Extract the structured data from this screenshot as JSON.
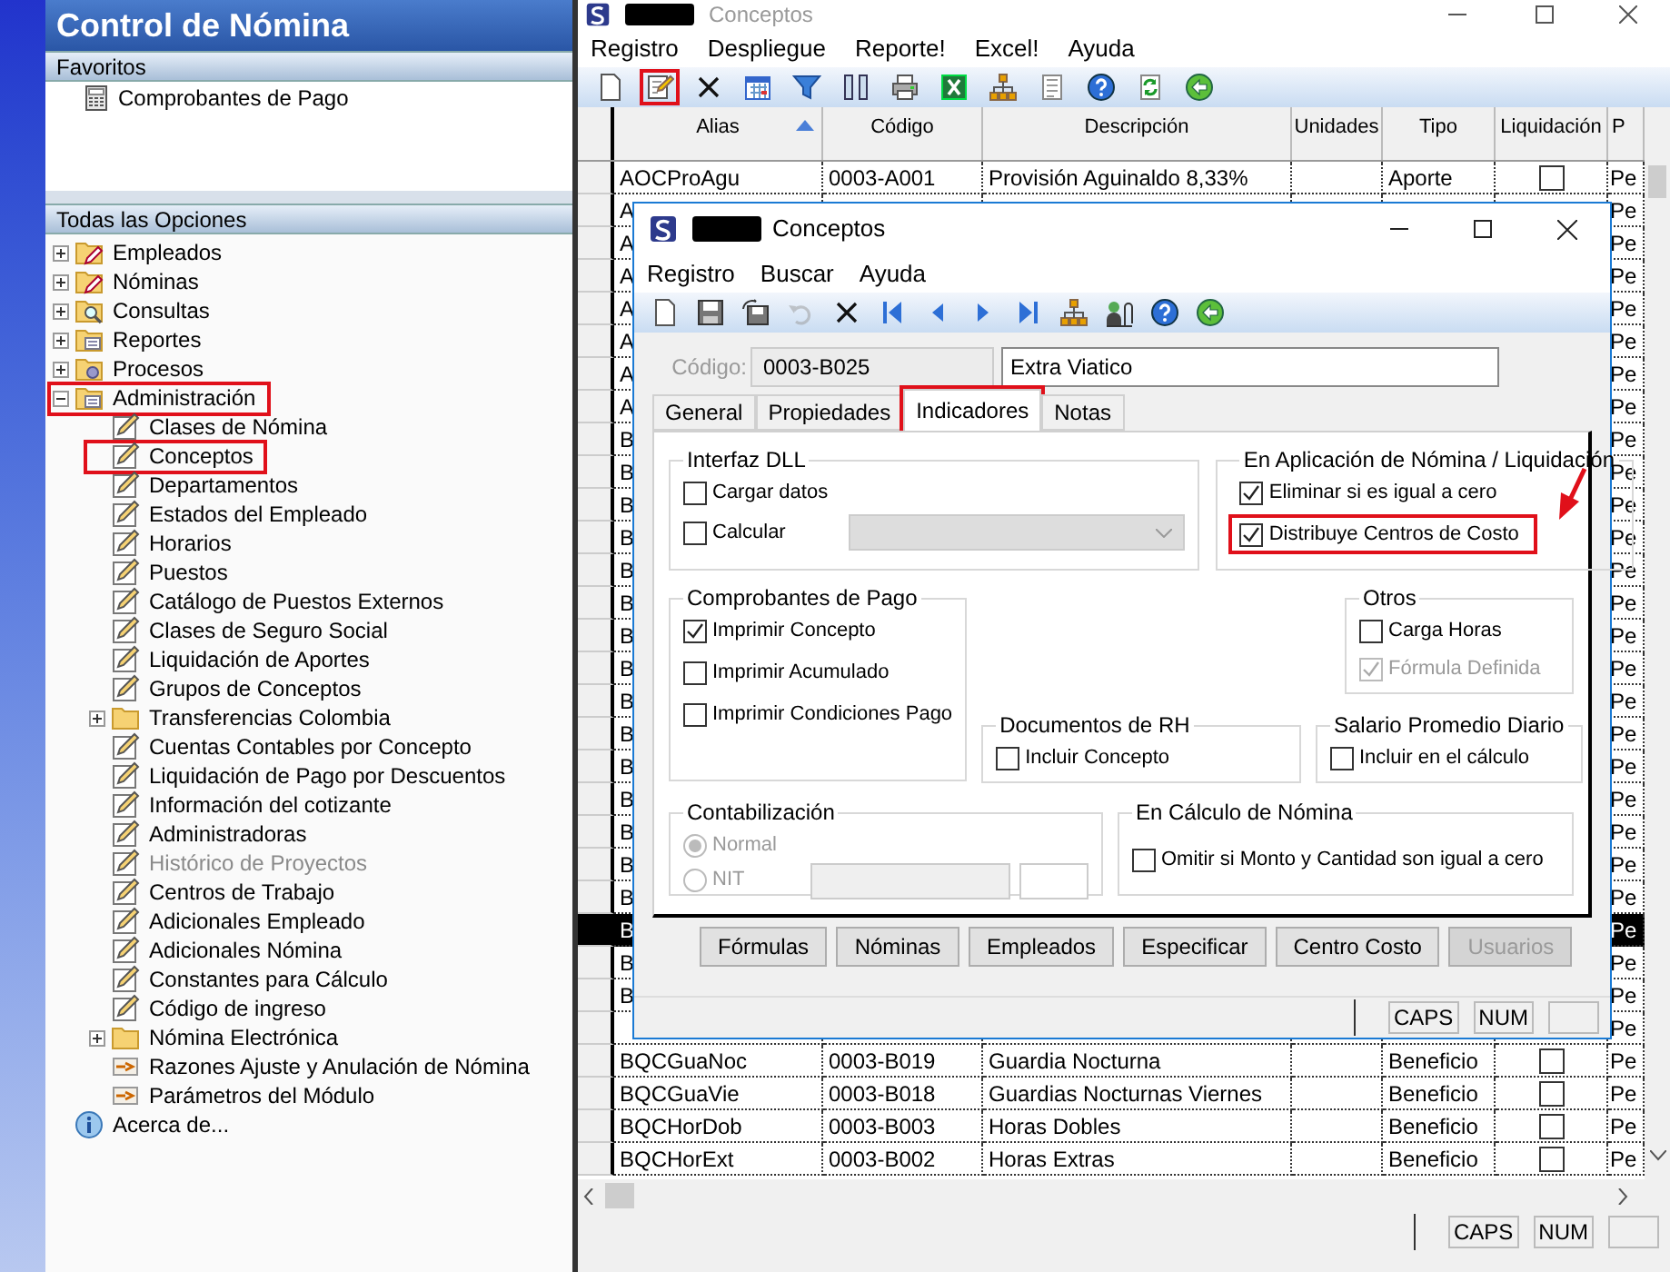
{
  "nav_panel": {
    "title": "Control de Nómina",
    "favorites": {
      "header": "Favoritos",
      "items": [
        {
          "label": "Comprobantes de Pago",
          "kind": "calculator"
        }
      ]
    },
    "all_options": {
      "header": "Todas las Opciones",
      "tree": [
        {
          "label": "Empleados",
          "kind": "folder_edit",
          "expanded": false,
          "disabled": false,
          "highlighted": false
        },
        {
          "label": "Nóminas",
          "kind": "folder_edit",
          "expanded": false,
          "disabled": false,
          "highlighted": false
        },
        {
          "label": "Consultas",
          "kind": "folder_search",
          "expanded": false,
          "disabled": false,
          "highlighted": false
        },
        {
          "label": "Reportes",
          "kind": "folder_list",
          "expanded": false,
          "disabled": false,
          "highlighted": false
        },
        {
          "label": "Procesos",
          "kind": "folder_gear",
          "expanded": false,
          "disabled": false,
          "highlighted": false
        },
        {
          "label": "Administración",
          "kind": "folder_list",
          "expanded": true,
          "disabled": false,
          "highlighted": true,
          "children": [
            {
              "label": "Clases de Nómina",
              "kind": "page",
              "disabled": false,
              "highlighted": false
            },
            {
              "label": "Conceptos",
              "kind": "page",
              "disabled": false,
              "highlighted": true
            },
            {
              "label": "Departamentos",
              "kind": "page",
              "disabled": false,
              "highlighted": false
            },
            {
              "label": "Estados del Empleado",
              "kind": "page",
              "disabled": false,
              "highlighted": false
            },
            {
              "label": "Horarios",
              "kind": "page",
              "disabled": false,
              "highlighted": false
            },
            {
              "label": "Puestos",
              "kind": "page",
              "disabled": false,
              "highlighted": false
            },
            {
              "label": "Catálogo de Puestos Externos",
              "kind": "page",
              "disabled": false,
              "highlighted": false
            },
            {
              "label": "Clases de Seguro Social",
              "kind": "page",
              "disabled": false,
              "highlighted": false
            },
            {
              "label": "Liquidación de Aportes",
              "kind": "page",
              "disabled": false,
              "highlighted": false
            },
            {
              "label": "Grupos de Conceptos",
              "kind": "page",
              "disabled": false,
              "highlighted": false
            },
            {
              "label": "Transferencias Colombia",
              "kind": "folder",
              "expanded": false,
              "disabled": false,
              "highlighted": false
            },
            {
              "label": "Cuentas Contables por Concepto",
              "kind": "page",
              "disabled": false,
              "highlighted": false
            },
            {
              "label": "Liquidación de Pago por Descuentos",
              "kind": "page",
              "disabled": false,
              "highlighted": false
            },
            {
              "label": "Información del cotizante",
              "kind": "page",
              "disabled": false,
              "highlighted": false
            },
            {
              "label": "Administradoras",
              "kind": "page",
              "disabled": false,
              "highlighted": false
            },
            {
              "label": "Histórico de Proyectos",
              "kind": "page",
              "disabled": true,
              "highlighted": false
            },
            {
              "label": "Centros de Trabajo",
              "kind": "page",
              "disabled": false,
              "highlighted": false
            },
            {
              "label": "Adicionales Empleado",
              "kind": "page",
              "disabled": false,
              "highlighted": false
            },
            {
              "label": "Adicionales Nómina",
              "kind": "page",
              "disabled": false,
              "highlighted": false
            },
            {
              "label": "Constantes para Cálculo",
              "kind": "page",
              "disabled": false,
              "highlighted": false
            },
            {
              "label": "Código de ingreso",
              "kind": "page",
              "disabled": false,
              "highlighted": false
            },
            {
              "label": "Nómina Electrónica",
              "kind": "folder",
              "expanded": false,
              "disabled": false,
              "highlighted": false
            },
            {
              "label": "Razones Ajuste y Anulación de Nómina",
              "kind": "tool",
              "disabled": false,
              "highlighted": false
            },
            {
              "label": "Parámetros del Módulo",
              "kind": "tool",
              "disabled": false,
              "highlighted": false
            }
          ]
        },
        {
          "label": "Acerca de...",
          "kind": "info",
          "disabled": false,
          "highlighted": false
        }
      ]
    }
  },
  "main_window": {
    "title": "Conceptos",
    "menu": [
      "Registro",
      "Despliegue",
      "Reporte!",
      "Excel!",
      "Ayuda"
    ],
    "toolbar": [
      {
        "kind": "new",
        "highlighted": false
      },
      {
        "kind": "edit",
        "highlighted": true
      },
      {
        "kind": "delete",
        "highlighted": false
      },
      {
        "kind": "calendar",
        "highlighted": false
      },
      {
        "kind": "filter",
        "highlighted": false
      },
      {
        "kind": "columns",
        "highlighted": false
      },
      {
        "kind": "print",
        "highlighted": false
      },
      {
        "kind": "excel",
        "highlighted": false
      },
      {
        "kind": "tree",
        "highlighted": false
      },
      {
        "kind": "document",
        "highlighted": false
      },
      {
        "kind": "help",
        "highlighted": false
      },
      {
        "kind": "refresh",
        "highlighted": false
      },
      {
        "kind": "back",
        "highlighted": false
      }
    ],
    "table": {
      "columns": [
        {
          "label": "Alias",
          "sorted": true
        },
        {
          "label": "Código",
          "sorted": false
        },
        {
          "label": "Descripción",
          "sorted": false
        },
        {
          "label": "Unidades",
          "sorted": false
        },
        {
          "label": "Tipo",
          "sorted": false
        },
        {
          "label": "Liquidación",
          "sorted": false
        },
        {
          "label": "P",
          "sorted": false
        }
      ],
      "rows": [
        {
          "alias": "AOCProAgu",
          "code": "0003-A001",
          "description": "Provisión Aguinaldo 8,33%",
          "type": "Aporte",
          "settlement": false,
          "column_7": "Pe",
          "selected": false
        },
        {
          "alias": "A",
          "column_7": "Pe",
          "selected": false
        },
        {
          "alias": "A",
          "column_7": "Pe",
          "selected": false
        },
        {
          "alias": "A",
          "column_7": "Pe",
          "selected": false
        },
        {
          "alias": "A",
          "column_7": "Pe",
          "selected": false
        },
        {
          "alias": "A",
          "column_7": "Pe",
          "selected": false
        },
        {
          "alias": "A",
          "column_7": "Pe",
          "selected": false
        },
        {
          "alias": "A",
          "column_7": "Pe",
          "selected": false
        },
        {
          "alias": "B",
          "column_7": "Pe",
          "selected": false
        },
        {
          "alias": "B",
          "column_7": "Pe",
          "selected": false
        },
        {
          "alias": "B",
          "column_7": "Pe",
          "selected": false
        },
        {
          "alias": "B",
          "column_7": "Pe",
          "selected": false
        },
        {
          "alias": "B",
          "column_7": "Pe",
          "selected": false
        },
        {
          "alias": "B",
          "column_7": "Pe",
          "selected": false
        },
        {
          "alias": "B",
          "column_7": "Pe",
          "selected": false
        },
        {
          "alias": "B",
          "column_7": "Pe",
          "selected": false
        },
        {
          "alias": "B",
          "column_7": "Pe",
          "selected": false
        },
        {
          "alias": "B",
          "column_7": "Pe",
          "selected": false
        },
        {
          "alias": "B",
          "column_7": "Pe",
          "selected": false
        },
        {
          "alias": "B",
          "column_7": "Pe",
          "selected": false
        },
        {
          "alias": "B",
          "column_7": "Pe",
          "selected": false
        },
        {
          "alias": "B",
          "column_7": "Pe",
          "selected": false
        },
        {
          "alias": "B",
          "column_7": "Pe",
          "selected": false
        },
        {
          "alias": "B",
          "column_7": "Pe",
          "selected": true
        },
        {
          "alias": "B",
          "column_7": "Pe",
          "selected": false
        },
        {
          "alias": "B",
          "column_7": "Pe",
          "selected": false
        },
        {
          "column_7": "Pe",
          "selected": false
        },
        {
          "alias": "BQCGuaNoc",
          "code": "0003-B019",
          "description": "Guardia Nocturna",
          "type": "Beneficio",
          "settlement": false,
          "column_7": "Pe",
          "selected": false
        },
        {
          "alias": "BQCGuaVie",
          "code": "0003-B018",
          "description": "Guardias Nocturnas Viernes",
          "type": "Beneficio",
          "settlement": false,
          "column_7": "Pe",
          "selected": false
        },
        {
          "alias": "BQCHorDob",
          "code": "0003-B003",
          "description": "Horas Dobles",
          "type": "Beneficio",
          "settlement": false,
          "column_7": "Pe",
          "selected": false
        },
        {
          "alias": "BQCHorExt",
          "code": "0003-B002",
          "description": "Horas Extras",
          "type": "Beneficio",
          "settlement": false,
          "column_7": "Pe",
          "selected": false
        }
      ]
    },
    "status_bar": [
      "CAPS",
      "NUM"
    ]
  },
  "dialog": {
    "title": "Conceptos",
    "menu": [
      "Registro",
      "Buscar",
      "Ayuda"
    ],
    "toolbar": [
      {
        "kind": "new",
        "disabled": false
      },
      {
        "kind": "save",
        "disabled": false
      },
      {
        "kind": "saveas",
        "disabled": false
      },
      {
        "kind": "undo",
        "disabled": true
      },
      {
        "kind": "delete",
        "disabled": false
      },
      {
        "kind": "first",
        "disabled": false
      },
      {
        "kind": "prev",
        "disabled": false
      },
      {
        "kind": "next",
        "disabled": false
      },
      {
        "kind": "last",
        "disabled": false
      },
      {
        "kind": "tree",
        "disabled": false
      },
      {
        "kind": "attach",
        "disabled": false
      },
      {
        "kind": "help",
        "disabled": false
      },
      {
        "kind": "back",
        "disabled": false
      }
    ],
    "code_label": "Código:",
    "code_value": "0003-B025",
    "name_value": "Extra Viatico",
    "tabs": [
      {
        "label": "General",
        "selected": false,
        "highlighted": false
      },
      {
        "label": "Propiedades",
        "selected": false,
        "highlighted": false
      },
      {
        "label": "Indicadores",
        "selected": true,
        "highlighted": true
      },
      {
        "label": "Notas",
        "selected": false,
        "highlighted": false
      }
    ],
    "groups": [
      {
        "title": "Interfaz DLL",
        "items": [
          {
            "kind": "checkbox",
            "label": "Cargar datos",
            "checked": false,
            "disabled": false,
            "highlighted": false,
            "combo": false
          },
          {
            "kind": "checkbox",
            "label": "Calcular",
            "checked": false,
            "disabled": false,
            "highlighted": false,
            "combo": true
          }
        ]
      },
      {
        "title": "En Aplicación de Nómina / Liquidación",
        "items": [
          {
            "kind": "checkbox",
            "label": "Eliminar si es igual a cero",
            "checked": true,
            "disabled": false,
            "highlighted": false,
            "combo": false
          },
          {
            "kind": "checkbox",
            "label": "Distribuye Centros de Costo",
            "checked": true,
            "disabled": false,
            "highlighted": true,
            "combo": false
          }
        ]
      },
      {
        "title": "Comprobantes de Pago",
        "items": [
          {
            "kind": "checkbox",
            "label": "Imprimir Concepto",
            "checked": true,
            "disabled": false,
            "highlighted": false,
            "combo": false
          },
          {
            "kind": "checkbox",
            "label": "Imprimir Acumulado",
            "checked": false,
            "disabled": false,
            "highlighted": false,
            "combo": false
          },
          {
            "kind": "checkbox",
            "label": "Imprimir Condiciones Pago",
            "checked": false,
            "disabled": false,
            "highlighted": false,
            "combo": false
          }
        ]
      },
      {
        "title": "Documentos de RH",
        "items": [
          {
            "kind": "checkbox",
            "label": "Incluir Concepto",
            "checked": false,
            "disabled": false,
            "highlighted": false,
            "combo": false
          }
        ]
      },
      {
        "title": "Otros",
        "items": [
          {
            "kind": "checkbox",
            "label": "Carga Horas",
            "checked": false,
            "disabled": false,
            "highlighted": false,
            "combo": false
          },
          {
            "kind": "checkbox",
            "label": "Fórmula Definida",
            "checked": true,
            "disabled": true,
            "highlighted": false,
            "combo": false
          }
        ]
      },
      {
        "title": "Salario Promedio Diario",
        "items": [
          {
            "kind": "checkbox",
            "label": "Incluir en el cálculo",
            "checked": false,
            "disabled": false,
            "highlighted": false,
            "combo": false
          }
        ]
      },
      {
        "title": "Contabilización",
        "items": [
          {
            "kind": "radio",
            "label": "Normal",
            "selected": true,
            "disabled": true,
            "fields": false
          },
          {
            "kind": "radio",
            "label": "NIT",
            "selected": false,
            "disabled": true,
            "fields": true
          }
        ]
      },
      {
        "title": "En Cálculo de Nómina",
        "items": [
          {
            "kind": "checkbox",
            "label": "Omitir si Monto y Cantidad son igual a cero",
            "checked": false,
            "disabled": false,
            "highlighted": false,
            "combo": false
          }
        ]
      }
    ],
    "buttons": [
      {
        "label": "Fórmulas",
        "disabled": false
      },
      {
        "label": "Nóminas",
        "disabled": false
      },
      {
        "label": "Empleados",
        "disabled": false
      },
      {
        "label": "Especificar",
        "disabled": false
      },
      {
        "label": "Centro Costo",
        "disabled": false
      },
      {
        "label": "Usuarios",
        "disabled": true
      }
    ],
    "status_bar": [
      "CAPS",
      "NUM"
    ]
  },
  "annotation_arrow": true
}
